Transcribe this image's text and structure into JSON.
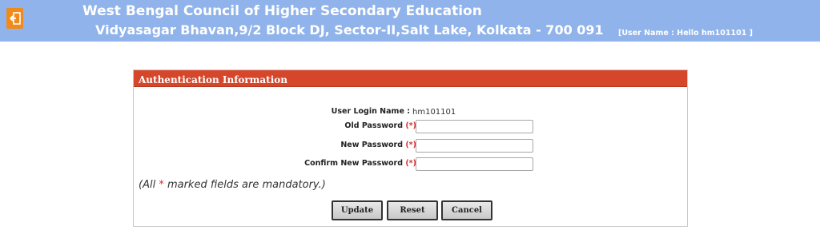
{
  "header": {
    "title": "West Bengal Council of Higher Secondary Education",
    "address": "Vidyasagar Bhavan,9/2 Block DJ, Sector-II,Salt Lake, Kolkata - 700 091",
    "user_info": "[User Name :  Hello hm101101 ]",
    "logout_icon": "logout-icon",
    "accent_color": "#8fb3ea"
  },
  "panel": {
    "title": "Authentication Information",
    "header_color": "#d6462a",
    "fields": {
      "login_name_label": "User Login Name :",
      "login_name_value": "hm101101",
      "old_password_label": "Old Password",
      "new_password_label": "New Password",
      "confirm_password_label": "Confirm New Password",
      "required_marker": "(*)",
      "old_password_value": "",
      "new_password_value": "",
      "confirm_password_value": ""
    },
    "note_prefix": "(All ",
    "note_star": "*",
    "note_suffix": " marked fields are mandatory.)",
    "buttons": {
      "update": "Update",
      "reset": "Reset",
      "cancel": "Cancel"
    }
  }
}
